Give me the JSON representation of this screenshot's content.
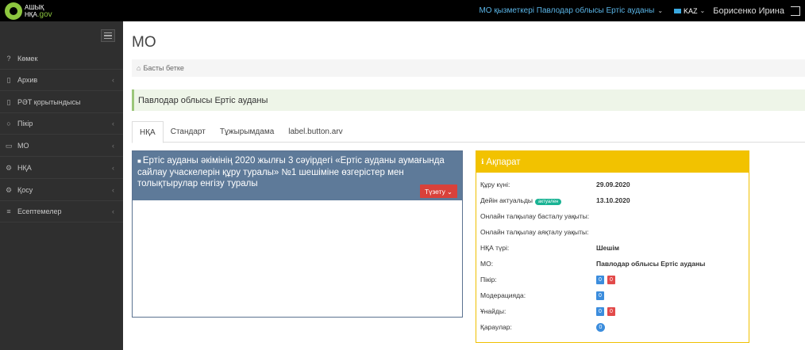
{
  "topbar": {
    "logo_line1": "АШЫҚ",
    "logo_line2": "НҚА",
    "logo_gov": ".gov",
    "org": "МО қызметкері Павлодар облысы Ертіс ауданы",
    "lang": "KAZ",
    "user": "Борисенко Ирина"
  },
  "sidebar": {
    "items": [
      {
        "icon": "?",
        "label": "Көмек",
        "arrow": ""
      },
      {
        "icon": "▯",
        "label": "Архив",
        "arrow": "‹"
      },
      {
        "icon": "▯",
        "label": "РӘТ қорытындысы",
        "arrow": ""
      },
      {
        "icon": "○",
        "label": "Пікір",
        "arrow": "‹"
      },
      {
        "icon": "▭",
        "label": "МО",
        "arrow": "‹"
      },
      {
        "icon": "⚙",
        "label": "НҚА",
        "arrow": "‹"
      },
      {
        "icon": "⚙",
        "label": "Қосу",
        "arrow": "‹"
      },
      {
        "icon": "≡",
        "label": "Есептемелер",
        "arrow": "‹"
      }
    ]
  },
  "main": {
    "title": "МО",
    "breadcrumb": "Басты бетке",
    "alert": "Павлодар облысы Ертіс ауданы",
    "tabs": [
      "НҚА",
      "Стандарт",
      "Тұжырымдама",
      "label.button.arv"
    ],
    "panel": {
      "title": "Ертіс ауданы әкімінің 2020 жылғы 3 сәуірдегі «Ертіс ауданы аумағында сайлау учаскелерін құру туралы» №1 шешіміне өзгерістер мен толықтырулар енгізу туралы",
      "edit_button": "Түзету"
    }
  },
  "info": {
    "title": "Ақпарат",
    "rows": [
      {
        "label": "Құру күні:",
        "value": "29.09.2020"
      },
      {
        "label": "Дейін актуальды",
        "pill": "актуален",
        "value": "13.10.2020"
      },
      {
        "label": "Онлайн талқылау басталу уақыты:",
        "value": ""
      },
      {
        "label": "Онлайн талқылау аяқталу уақыты:",
        "value": ""
      },
      {
        "label": "НҚА түрі:",
        "value": "Шешім"
      },
      {
        "label": "МО:",
        "value": "Павлодар облысы Ертіс ауданы"
      },
      {
        "label": "Пікір:",
        "blue": "0",
        "red": "0"
      },
      {
        "label": "Модерацияда:",
        "blue": "0"
      },
      {
        "label": "Ұнайды:",
        "blue": "0",
        "red": "0"
      },
      {
        "label": "Қараулар:",
        "circle": "0"
      }
    ]
  },
  "colors": {
    "topbar": "#000000",
    "sidebar": "#2f2f2f",
    "panel_header": "#5e7a99",
    "info_header": "#f2c200",
    "edit_button": "#d9413a"
  }
}
